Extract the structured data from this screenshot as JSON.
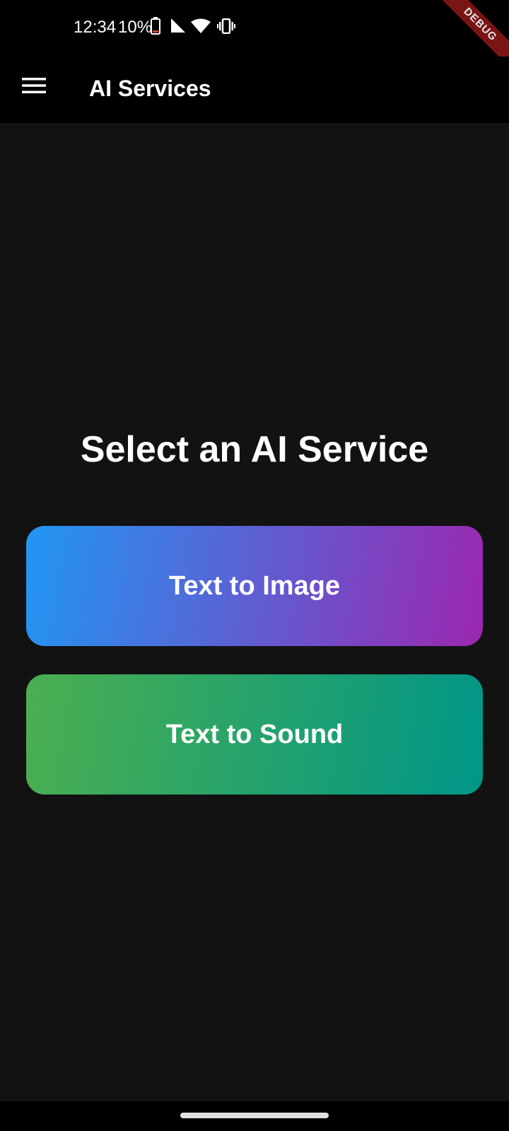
{
  "status_bar": {
    "time": "12:34",
    "battery_percent": "10%",
    "icons": [
      "battery-low-icon",
      "cell-signal-icon",
      "wifi-icon",
      "vibrate-icon"
    ]
  },
  "debug_banner": {
    "label": "DEBUG",
    "color": "#7a1515"
  },
  "app_bar": {
    "title": "AI Services",
    "menu_icon": "hamburger-menu-icon"
  },
  "main": {
    "heading": "Select an AI Service",
    "services": [
      {
        "label": "Text to Image",
        "gradient": [
          "#2196f3",
          "#9c27b0"
        ]
      },
      {
        "label": "Text to Sound",
        "gradient": [
          "#4caf50",
          "#009688"
        ]
      }
    ]
  },
  "colors": {
    "background": "#121212",
    "app_bar": "#000000",
    "text": "#ffffff"
  }
}
